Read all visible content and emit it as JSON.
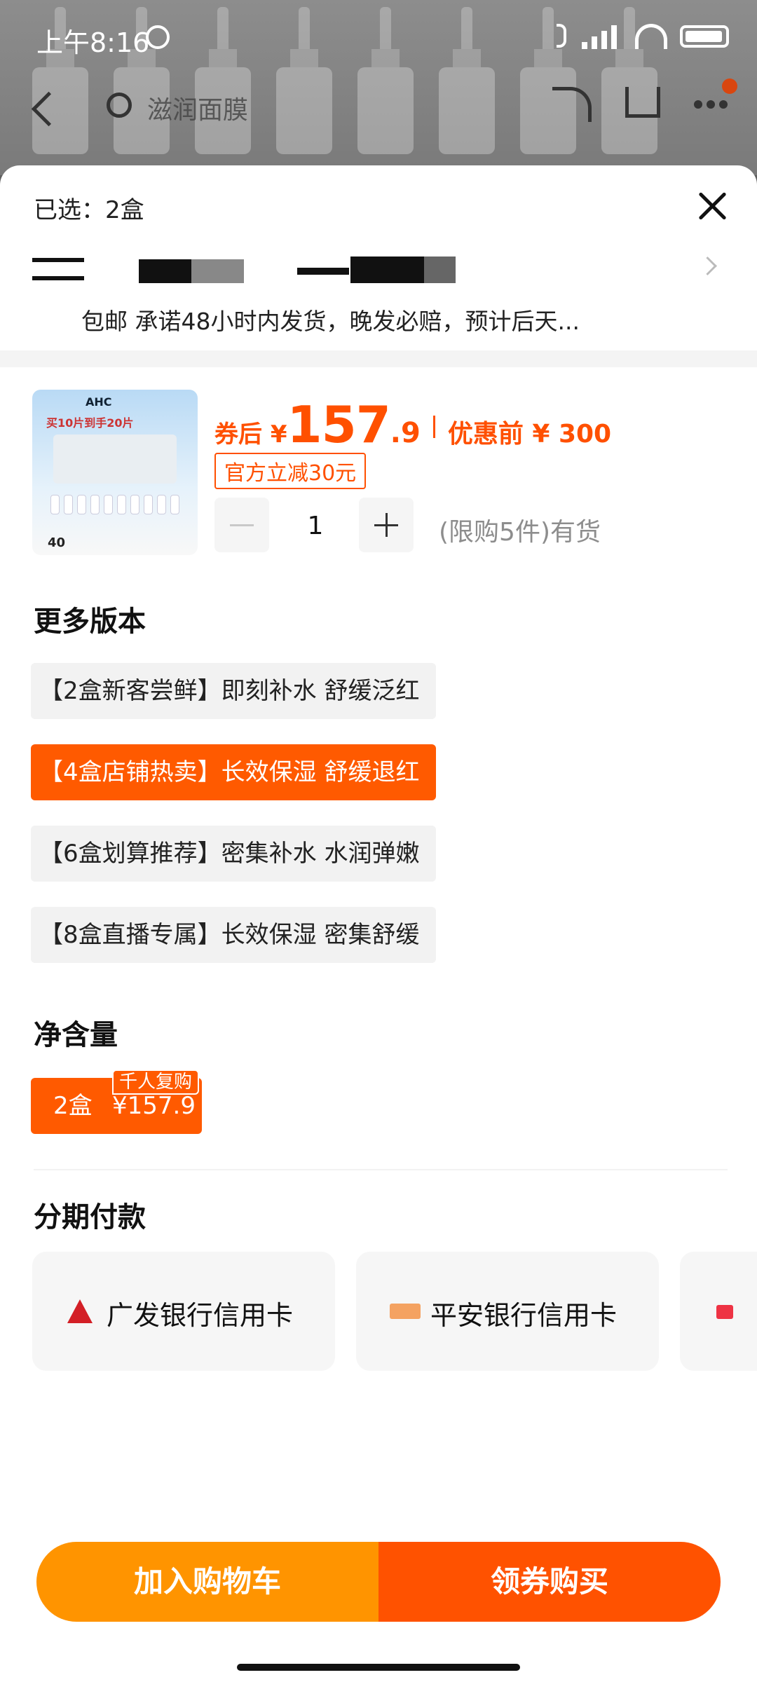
{
  "status_bar": {
    "time": "上午8:16",
    "network": "HD"
  },
  "nav": {
    "search_hint": "滋润面膜"
  },
  "sheet": {
    "selected": "已选：2盒",
    "shipping": "包邮 承诺48小时内发货，晚发必赔，预计后天...",
    "product": {
      "price_prefix": "券后 ¥",
      "price_int": "157",
      "price_dec": ".9",
      "pre_price": "优惠前 ¥ 300",
      "coupon": "官方立减30元",
      "qty": "1",
      "stock": "(限购5件)有货",
      "image": {
        "brand": "AHC",
        "tagline": "买10片到手20片",
        "price_mini": "40"
      }
    },
    "versions_title": "更多版本",
    "versions": [
      {
        "label": "【2盒新客尝鲜】即刻补水 舒缓泛红",
        "selected": false
      },
      {
        "label": "【4盒店铺热卖】长效保湿 舒缓退红",
        "selected": true
      },
      {
        "label": "【6盒划算推荐】密集补水 水润弹嫩",
        "selected": false
      },
      {
        "label": "【8盒直播专属】长效保湿 密集舒缓",
        "selected": false
      }
    ],
    "net_title": "净含量",
    "net_option": {
      "qty": "2盒",
      "price": "¥157.9",
      "tag": "千人复购"
    },
    "installment_title": "分期付款",
    "banks": [
      {
        "label": "广发银行信用卡",
        "icon": "gf-bank-icon"
      },
      {
        "label": "平安银行信用卡",
        "icon": "pingan-bank-icon"
      }
    ]
  },
  "actions": {
    "add_cart": "加入购物车",
    "buy": "领券购买"
  },
  "colors": {
    "accent": "#ff5a00",
    "cart_btn": "#ff9400",
    "buy_btn": "#ff5200"
  }
}
